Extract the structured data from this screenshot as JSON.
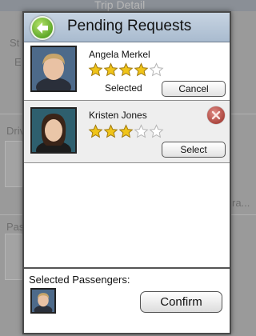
{
  "background": {
    "title": "Trip Detail",
    "fragments": [
      "St",
      "E",
      "Driv",
      "Pas",
      "ra..."
    ]
  },
  "modal": {
    "title": "Pending Requests",
    "requests": [
      {
        "name": "Angela Merkel",
        "rating": 4,
        "max_rating": 5,
        "status_label": "Selected",
        "action_label": "Cancel"
      },
      {
        "name": "Kristen Jones",
        "rating": 3,
        "max_rating": 5,
        "action_label": "Select"
      }
    ],
    "footer": {
      "label": "Selected Passengers:",
      "confirm_label": "Confirm"
    }
  },
  "colors": {
    "header": "#b6c6d8",
    "back_button": "#6cb33a",
    "remove_icon": "#b84a42",
    "star": "#f0c419"
  },
  "icons": {
    "back": "arrow-left-icon",
    "remove": "close-icon",
    "star": "star-icon"
  }
}
